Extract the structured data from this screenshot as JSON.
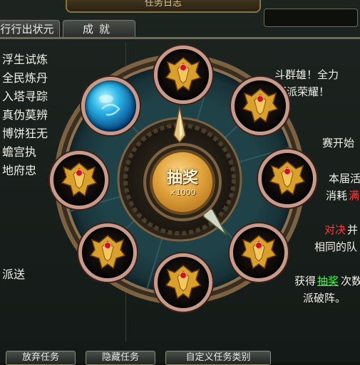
{
  "window": {
    "title": "任务日志"
  },
  "tabs": [
    {
      "label": "行行出状元"
    },
    {
      "label": "成就"
    }
  ],
  "quest_list": [
    {
      "label": "浮生试炼"
    },
    {
      "label": "全民炼丹"
    },
    {
      "label": "入塔寻踪"
    },
    {
      "label": "真伪莫辨"
    },
    {
      "label": "博饼狂无"
    },
    {
      "label": "蟾宫执"
    },
    {
      "label": "地府忠"
    },
    {
      "label": "派送"
    }
  ],
  "detail_fragments": [
    {
      "text": "斗群雄！全力"
    },
    {
      "text": "帮派荣耀！"
    },
    {
      "text": "赛开始"
    },
    {
      "text": "本届活"
    },
    {
      "text": "消耗"
    },
    {
      "text": "满"
    },
    {
      "text": "对决"
    },
    {
      "text": "并"
    },
    {
      "text": "相同的队"
    },
    {
      "text": "获得"
    },
    {
      "text": "抽奖"
    },
    {
      "text": "次数"
    },
    {
      "text": "派破阵。"
    }
  ],
  "bottom_buttons": [
    {
      "label": "放弃任务"
    },
    {
      "label": "隐藏任务"
    },
    {
      "label": "自定义任务类别"
    }
  ],
  "lottery": {
    "button_label": "抽奖",
    "cost": "×1000",
    "pointer_angle_deg": 0,
    "slots": [
      {
        "icon": "dragon-emblem-icon"
      },
      {
        "icon": "dragon-emblem-icon"
      },
      {
        "icon": "dragon-emblem-icon"
      },
      {
        "icon": "dragon-emblem-icon"
      },
      {
        "icon": "dragon-emblem-icon"
      },
      {
        "icon": "dragon-emblem-icon"
      },
      {
        "icon": "dragon-emblem-icon"
      },
      {
        "icon": "blue-orb-icon"
      }
    ]
  },
  "colors": {
    "accent_gold": "#e0a23a",
    "wheel_teal": "#1d3c42",
    "highlight_red": "#ff3b3b",
    "link_green": "#3cff3c"
  }
}
